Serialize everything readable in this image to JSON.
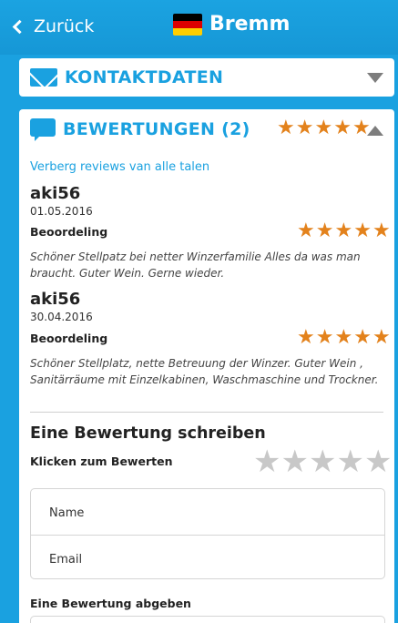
{
  "header": {
    "back_label": "Zurück",
    "title": "Bremm",
    "flag_colors": [
      "#000000",
      "#dd0000",
      "#ffce00"
    ]
  },
  "contact": {
    "title": "KONTAKTDATEN"
  },
  "reviews": {
    "title": "BEWERTUNGEN (2)",
    "average_stars": 5,
    "hide_link": "Verberg reviews van alle talen",
    "items": [
      {
        "author": "aki56",
        "date": "01.05.2016",
        "rating_label": "Beoordeling",
        "rating": 5,
        "text": "Schöner Stellpatz bei netter Winzerfamilie Alles da was man braucht. Guter Wein. Gerne wieder."
      },
      {
        "author": "aki56",
        "date": "30.04.2016",
        "rating_label": "Beoordeling",
        "rating": 5,
        "text": "Schöner Stellplatz, nette Betreuung der Winzer. Guter Wein , Sanitärräume mit Einzelkabinen, Waschmaschine und Trockner."
      }
    ]
  },
  "write": {
    "title": "Eine Bewertung schreiben",
    "rate_label": "Klicken zum Bewerten",
    "name_placeholder": "Name",
    "email_placeholder": "Email",
    "submit_label": "Eine Bewertung abgeben"
  },
  "colors": {
    "accent": "#1aa1e0",
    "star": "#e3821c",
    "star_empty": "#c8c8c8"
  }
}
